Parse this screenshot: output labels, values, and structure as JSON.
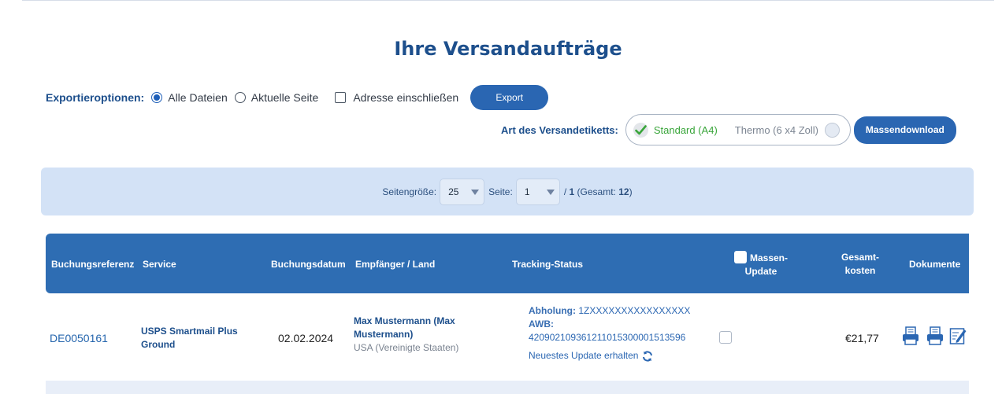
{
  "page": {
    "title": "Ihre Versandaufträge"
  },
  "export": {
    "label": "Exportieroptionen:",
    "option_all": "Alle Dateien",
    "option_current": "Aktuelle Seite",
    "include_address": "Adresse einschließen",
    "button": "Export",
    "selected": "Alle Dateien"
  },
  "label_type": {
    "label": "Art des Versandetiketts:",
    "standard": "Standard (A4)",
    "thermo": "Thermo (6 x4 Zoll)",
    "selected": "Standard (A4)",
    "mass_download": "Massendownload"
  },
  "pager": {
    "page_size_label": "Seitengröße:",
    "page_size": "25",
    "page_label": "Seite:",
    "page": "1",
    "of_prefix": "/",
    "total_pages": "1",
    "total_prefix": "(Gesamt:",
    "total_count": "12",
    "total_suffix": ")"
  },
  "table": {
    "headers": {
      "ref": "Buchungsreferenz",
      "service": "Service",
      "date": "Buchungsdatum",
      "recipient": "Empfänger / Land",
      "tracking": "Tracking-Status",
      "mass_line1": "Massen-",
      "mass_line2": "Update",
      "cost_line1": "Gesamt-",
      "cost_line2": "kosten",
      "docs": "Dokumente"
    },
    "rows": [
      {
        "ref": "DE0050161",
        "service": "USPS Smartmail Plus Ground",
        "date": "02.02.2024",
        "recipient_name": "Max Mustermann (Max Mustermann)",
        "recipient_country": "USA (Vereinigte Staaten)",
        "pickup_label": "Abholung:",
        "pickup_value": "1ZXXXXXXXXXXXXXXXX",
        "awb_label": "AWB:",
        "awb_value": "420902109361211015300001513596",
        "update_link": "Neuestes Update erhalten",
        "cost": "€21,77"
      }
    ]
  },
  "colors": {
    "primary": "#2a66b2",
    "header_bg": "#2e6db3",
    "pager_bg": "#d3e2f6",
    "success": "#39a53a"
  },
  "icons": [
    "check-circle-icon",
    "refresh-icon",
    "printer-icon",
    "edit-icon"
  ]
}
